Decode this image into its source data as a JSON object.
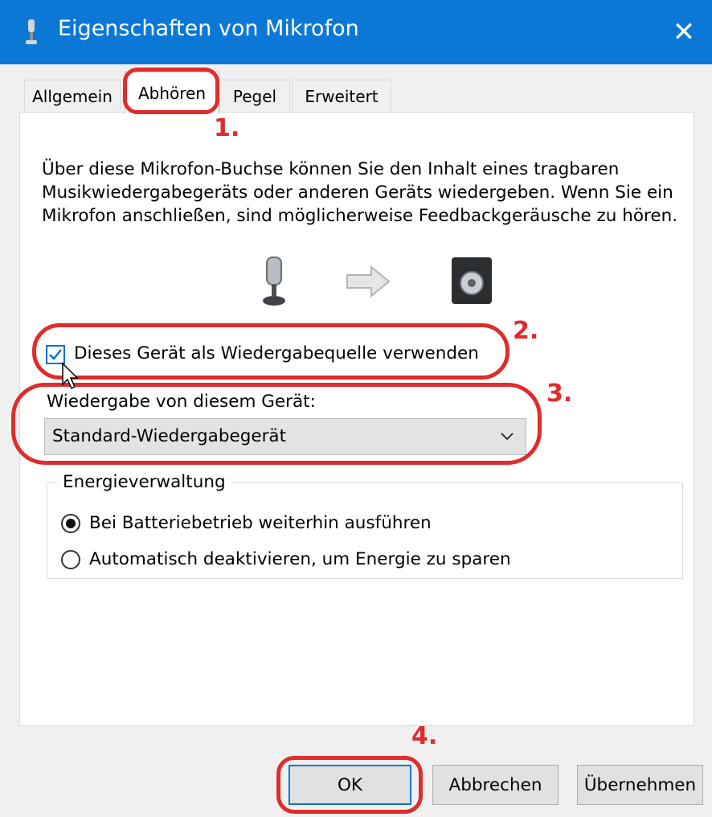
{
  "window": {
    "title": "Eigenschaften von Mikrofon",
    "close_glyph": "✕"
  },
  "tabs": [
    {
      "label": "Allgemein"
    },
    {
      "label": "Abhören",
      "active": true
    },
    {
      "label": "Pegel"
    },
    {
      "label": "Erweitert"
    }
  ],
  "description": "Über diese Mikrofon-Buchse können Sie den Inhalt eines tragbaren Musikwiedergabegeräts oder anderen Geräts wiedergeben. Wenn Sie ein Mikrofon anschließen, sind möglicherweise Feedbackgeräusche zu hören.",
  "listen_checkbox": {
    "label": "Dieses Gerät als Wiedergabequelle verwenden",
    "checked": true
  },
  "playback": {
    "label": "Wiedergabe von diesem Gerät:",
    "selected": "Standard-Wiedergabegerät"
  },
  "power": {
    "title": "Energieverwaltung",
    "options": [
      {
        "label": "Bei Batteriebetrieb weiterhin ausführen",
        "selected": true
      },
      {
        "label": "Automatisch deaktivieren, um Energie zu sparen",
        "selected": false
      }
    ]
  },
  "buttons": {
    "ok": "OK",
    "cancel": "Abbrechen",
    "apply": "Übernehmen"
  },
  "annotations": [
    "1.",
    "2.",
    "3.",
    "4."
  ],
  "colors": {
    "titlebar": "#0b78d6",
    "annotation": "#e02c2c",
    "accent": "#0b6fd1"
  }
}
